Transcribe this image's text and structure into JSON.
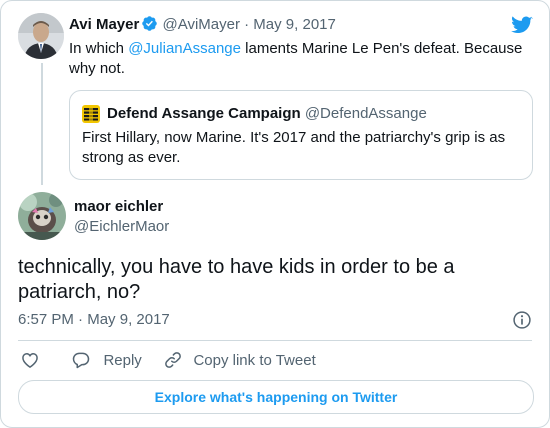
{
  "parent_tweet": {
    "author_name": "Avi Mayer",
    "handle": "@AviMayer",
    "separator": "·",
    "date": "May 9, 2017",
    "text_prefix": "In which ",
    "mention": "@JulianAssange",
    "text_suffix_line1": " laments Marine Le Pen's defeat. Because",
    "text_line2": "why not."
  },
  "quoted_tweet": {
    "author_name": "Defend Assange Campaign",
    "handle": "@DefendAssange",
    "text_line1": "First Hillary, now Marine. It's 2017 and the patriarchy's grip is as",
    "text_line2": "strong as ever."
  },
  "main_tweet": {
    "author_name": "maor eichler",
    "handle": "@EichlerMaor",
    "text_line1": "technically, you have to have kids in order to be a",
    "text_line2": "patriarch, no?",
    "time": "6:57 PM",
    "separator": "·",
    "date": "May 9, 2017"
  },
  "actions": {
    "reply_label": "Reply",
    "copy_label": "Copy link to Tweet"
  },
  "explore_label": "Explore what's happening on Twitter",
  "colors": {
    "twitter_blue": "#1d9bf0",
    "muted_text": "#536471",
    "border": "#cfd9de"
  },
  "icons": [
    "twitter-bird-icon",
    "verified-badge-icon",
    "info-icon",
    "heart-icon",
    "reply-icon",
    "copy-link-icon"
  ]
}
